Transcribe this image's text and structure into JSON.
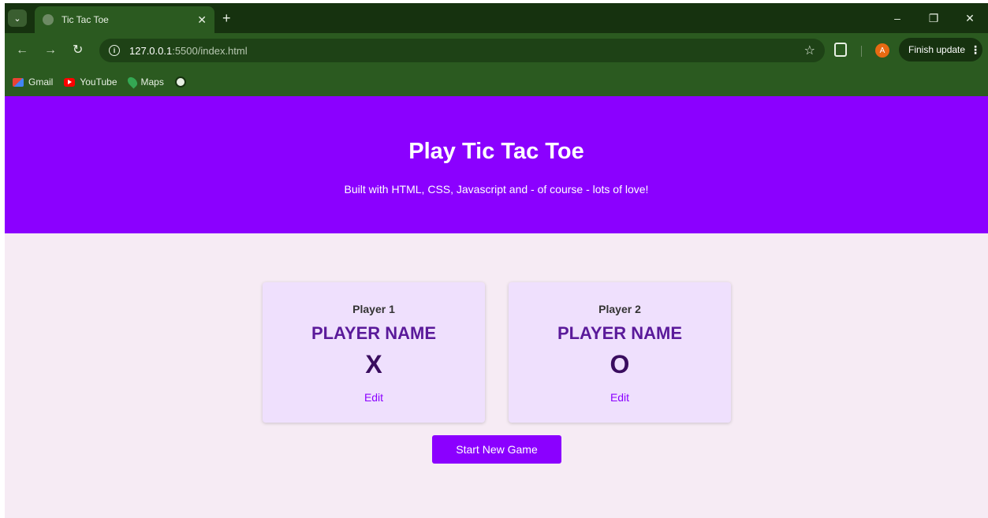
{
  "browser": {
    "tab_title": "Tic Tac Toe",
    "tab_close": "✕",
    "new_tab": "+",
    "url_host": "127.0.0.1",
    "url_rest": ":5500/index.html",
    "finish_update": "Finish update",
    "avatar_letter": "A",
    "bookmarks": [
      {
        "label": "Gmail",
        "icon": "gmail-icon"
      },
      {
        "label": "YouTube",
        "icon": "youtube-icon"
      },
      {
        "label": "Maps",
        "icon": "maps-icon"
      }
    ]
  },
  "header": {
    "title": "Play Tic Tac Toe",
    "subtitle": "Built with HTML, CSS, Javascript and - of course - lots of love!"
  },
  "players": [
    {
      "label": "Player 1",
      "name": "PLAYER NAME",
      "symbol": "X",
      "edit_label": "Edit"
    },
    {
      "label": "Player 2",
      "name": "PLAYER NAME",
      "symbol": "O",
      "edit_label": "Edit"
    }
  ],
  "start_button": {
    "label": "Start New Game"
  },
  "colors": {
    "header_bg": "#8b00ff",
    "page_bg": "#f6ebf4",
    "card_bg": "#efe0fd",
    "accent": "#8b00ff",
    "browser_theme": "#2b5a20"
  }
}
